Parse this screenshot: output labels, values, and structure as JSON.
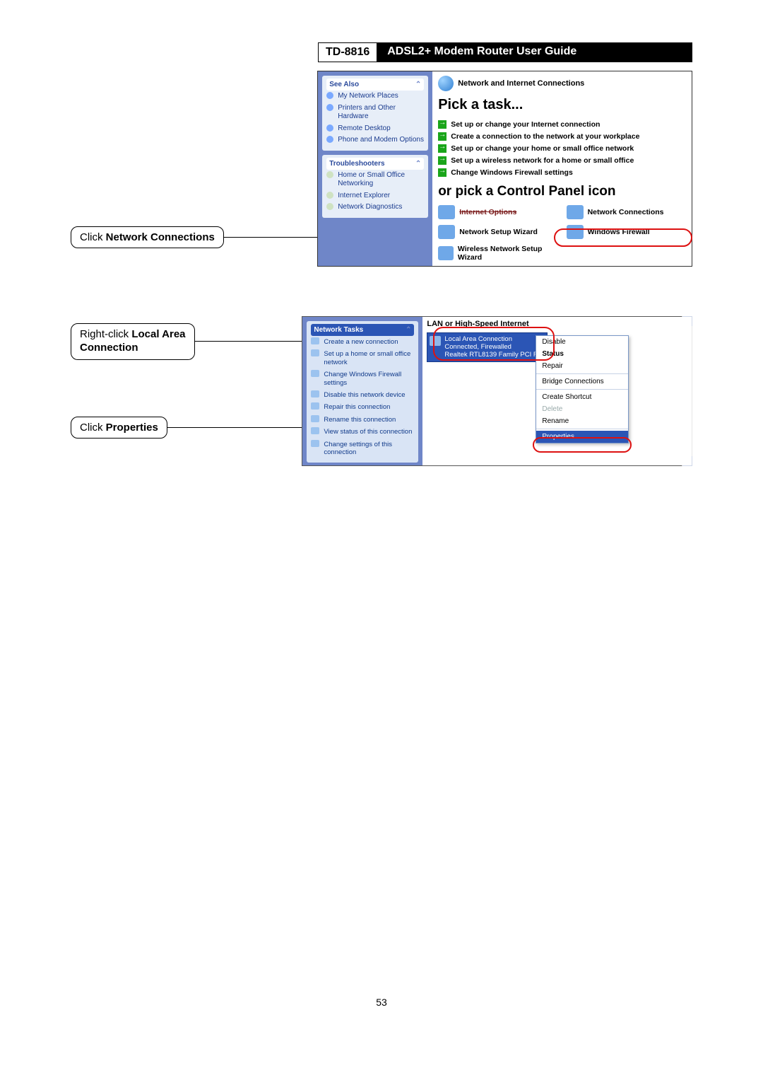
{
  "header": {
    "model": "TD-8816",
    "title": "ADSL2+  Modem  Router  User  Guide"
  },
  "callouts": {
    "network_connections_pre": "Click ",
    "network_connections_bold": "Network Connections",
    "rclick_pre": "Right-click ",
    "rclick_bold1": "Local Area",
    "rclick_bold2": "Connection",
    "properties_pre": "Click ",
    "properties_bold": "Properties"
  },
  "cp": {
    "see_also_title": "See Also",
    "see_also_items": [
      "My Network Places",
      "Printers and Other Hardware",
      "Remote Desktop",
      "Phone and Modem Options"
    ],
    "troubleshooters_title": "Troubleshooters",
    "troubleshooters_items": [
      "Home or Small Office Networking",
      "Internet Explorer",
      "Network Diagnostics"
    ],
    "category": "Network and Internet Connections",
    "pick_task": "Pick a task...",
    "tasks": [
      "Set up or change your Internet connection",
      "Create a connection to the network at your workplace",
      "Set up or change your home or small office network",
      "Set up a wireless network for a home or small office",
      "Change Windows Firewall settings"
    ],
    "or_pick": "or pick a Control Panel icon",
    "icons": {
      "internet_options": "Internet Options",
      "network_connections": "Network Connections",
      "network_setup_wizard": "Network Setup Wizard",
      "windows_firewall": "Windows Firewall",
      "wireless_setup": "Wireless Network Setup Wizard"
    }
  },
  "nc": {
    "panel_title": "Network Tasks",
    "tasks": [
      "Create a new connection",
      "Set up a home or small office network",
      "Change Windows Firewall settings",
      "Disable this network device",
      "Repair this connection",
      "Rename this connection",
      "View status of this connection",
      "Change settings of this connection"
    ],
    "section": "LAN or High-Speed Internet",
    "tile": {
      "line1": "Local Area Connection",
      "line2": "Connected, Firewalled",
      "line3": "Realtek RTL8139 Family PCI F..."
    },
    "menu": [
      "Disable",
      "Status",
      "Repair",
      "Bridge Connections",
      "Create Shortcut",
      "Delete",
      "Rename",
      "Properties"
    ]
  },
  "pagenum": "53"
}
